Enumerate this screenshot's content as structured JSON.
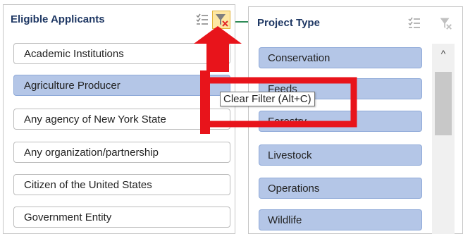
{
  "left_panel": {
    "title": "Eligible Applicants",
    "multiselect_icon": "multi-select-icon",
    "clear_filter_icon": "clear-filter-icon",
    "items": [
      {
        "label": "Academic Institutions",
        "selected": false
      },
      {
        "label": "Agriculture Producer",
        "selected": true
      },
      {
        "label": "Any agency of New York State",
        "selected": false
      },
      {
        "label": "Any organization/partnership",
        "selected": false
      },
      {
        "label": "Citizen of the United States",
        "selected": false
      },
      {
        "label": "Government Entity",
        "selected": false
      }
    ]
  },
  "right_panel": {
    "title": "Project Type",
    "multiselect_icon": "multi-select-icon",
    "clear_filter_icon": "clear-filter-icon",
    "items": [
      {
        "label": "Conservation"
      },
      {
        "label": "Feeds"
      },
      {
        "label": "Forestry"
      },
      {
        "label": "Livestock"
      },
      {
        "label": "Operations"
      },
      {
        "label": "Wildlife"
      }
    ],
    "scrollbar_up_glyph": "^"
  },
  "tooltip": {
    "text": "Clear Filter (Alt+C)"
  },
  "colors": {
    "selected_item_bg": "#b4c6e7",
    "annotation_red": "#e8141b",
    "header_text": "#1f3864"
  }
}
